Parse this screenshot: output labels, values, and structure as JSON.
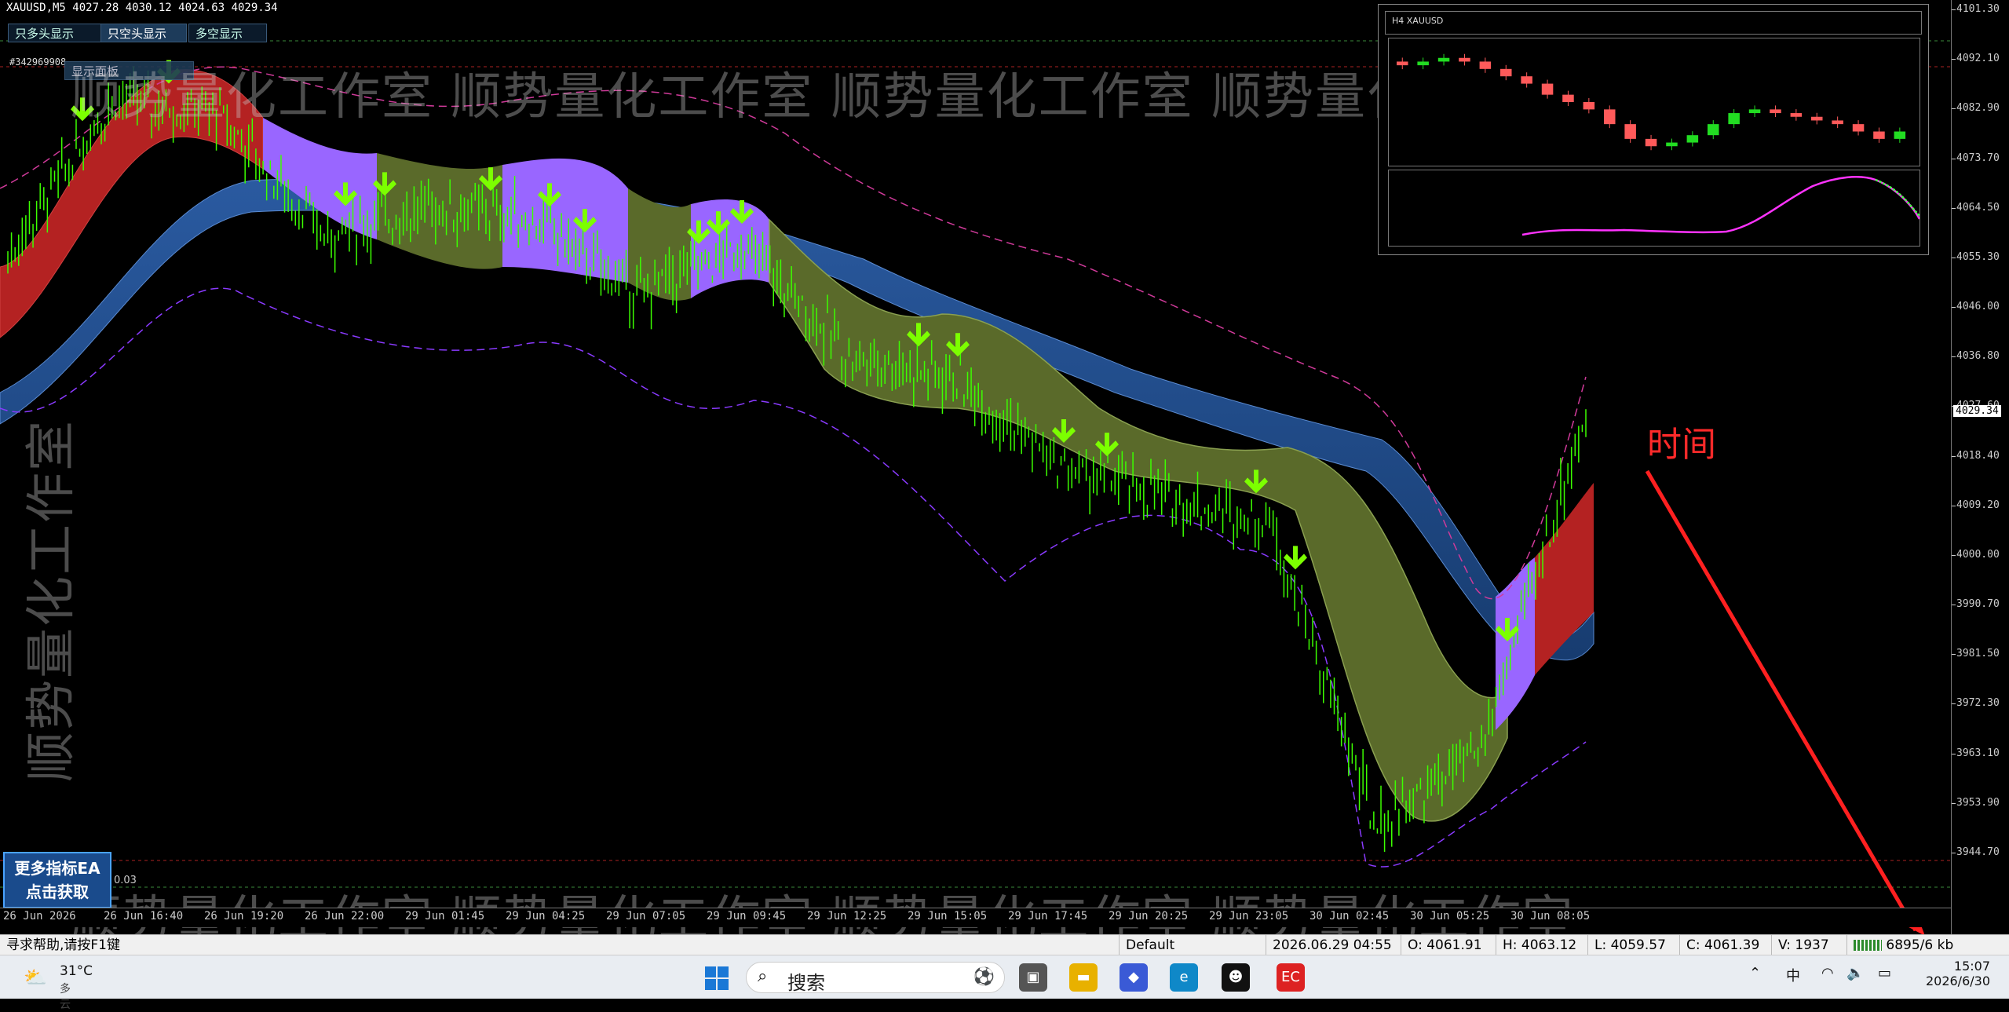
{
  "chart_header": {
    "title": "XAUUSD,M5  4027.28 4030.12 4024.63 4029.34",
    "order_id": "#342969908"
  },
  "controls": {
    "long_only": "只多头显示",
    "short_only": "只空头显示",
    "both": "多空显示",
    "show_panel": "显示面板"
  },
  "promo": {
    "line1": "更多指标EA",
    "line2": "点击获取"
  },
  "small_value": "0.03",
  "watermark": "顺势量化工作室 顺势量化工作室 顺势量化工作室 顺势量化工作室",
  "watermark_vertical": "顺势量化工作室",
  "annotation": {
    "text": "时间",
    "color": "#ff2a2a"
  },
  "price_axis": {
    "ticks": [
      "4101.30",
      "4092.10",
      "4082.90",
      "4073.70",
      "4064.50",
      "4055.30",
      "4046.00",
      "4036.80",
      "4027.60",
      "4018.40",
      "4009.20",
      "4000.00",
      "3990.70",
      "3981.50",
      "3972.30",
      "3963.10",
      "3953.90",
      "3944.70"
    ],
    "current": "4029.34"
  },
  "time_axis": {
    "ticks": [
      "26 Jun 2026",
      "26 Jun 16:40",
      "26 Jun 19:20",
      "26 Jun 22:00",
      "29 Jun 01:45",
      "29 Jun 04:25",
      "29 Jun 07:05",
      "29 Jun 09:45",
      "29 Jun 12:25",
      "29 Jun 15:05",
      "29 Jun 17:45",
      "29 Jun 20:25",
      "29 Jun 23:05",
      "30 Jun 02:45",
      "30 Jun 05:25",
      "30 Jun 08:05"
    ]
  },
  "mini_chart": {
    "title": "H4  XAUUSD"
  },
  "status_bar": {
    "help": "寻求帮助,请按F1键",
    "profile": "Default",
    "datetime": "2026.06.29 04:55",
    "open": "O: 4061.91",
    "high": "H: 4063.12",
    "low": "L: 4059.57",
    "close": "C: 4061.39",
    "volume": "V: 1937",
    "traffic": "6895/6 kb"
  },
  "taskbar": {
    "weather_temp": "31°C",
    "weather_desc": "多云",
    "search_placeholder": "搜索",
    "ime": "中",
    "time": "15:07",
    "date": "2026/6/30",
    "icons": [
      "start-icon",
      "search-icon",
      "browser-game-icon",
      "task-view-icon",
      "file-explorer-icon",
      "copilot-icon",
      "edge-icon",
      "qq-icon",
      "mt4-app-icon"
    ]
  },
  "colors": {
    "candle": "#3cff00",
    "ribbon_blue": "#1f4f8f",
    "ribbon_red": "#b42222",
    "ribbon_purple": "#9966ff",
    "ribbon_olive": "#5a6a2a",
    "arrow": "#7cff00",
    "envelope_pink": "#d03a9a",
    "envelope_violet": "#8a3aff"
  },
  "chart_data": {
    "type": "line",
    "title": "XAUUSD,M5",
    "xlabel": "",
    "ylabel": "",
    "ylim": [
      3940,
      4105
    ],
    "x": [
      "26 Jun 2026",
      "26 Jun 16:40",
      "26 Jun 19:20",
      "26 Jun 22:00",
      "29 Jun 01:45",
      "29 Jun 04:25",
      "29 Jun 07:05",
      "29 Jun 09:45",
      "29 Jun 12:25",
      "29 Jun 15:05",
      "29 Jun 17:45",
      "29 Jun 20:25",
      "29 Jun 23:05",
      "30 Jun 02:45",
      "30 Jun 05:25",
      "30 Jun 08:05"
    ],
    "series": [
      {
        "values": [
          4058,
          4087,
          4084,
          4062,
          4067,
          4065,
          4051,
          4060,
          4040,
          4036,
          4020,
          4014,
          4010,
          3954,
          3968,
          4029
        ]
      }
    ],
    "mini_h4": {
      "type": "candlestick",
      "title": "H4  XAUUSD",
      "closes": [
        4098,
        4099,
        4100,
        4099,
        4097,
        4095,
        4093,
        4090,
        4088,
        4086,
        4082,
        4078,
        4076,
        4077,
        4079,
        4082,
        4085,
        4086,
        4085,
        4084,
        4083,
        4082,
        4080,
        4078,
        4080
      ]
    }
  }
}
